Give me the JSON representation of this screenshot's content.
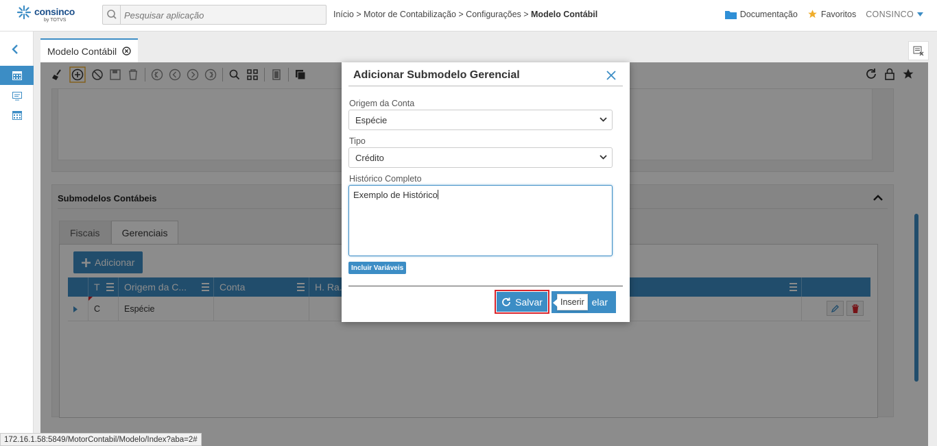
{
  "brand": {
    "name": "consinco",
    "sub": "by TOTVS"
  },
  "search": {
    "placeholder": "Pesquisar aplicação"
  },
  "breadcrumb": {
    "path": "Início > Motor de Contabilização > Configurações > ",
    "current": "Modelo Contábil"
  },
  "top_links": {
    "docs": "Documentação",
    "favorites": "Favoritos",
    "user": "CONSINCO"
  },
  "tab": {
    "label": "Modelo Contábil"
  },
  "section": {
    "title": "Submodelos Contábeis"
  },
  "subtabs": [
    {
      "label": "Fiscais"
    },
    {
      "label": "Gerenciais"
    }
  ],
  "grid": {
    "add_label": "Adicionar",
    "headers": {
      "t": "T",
      "origem": "Origem da C...",
      "conta": "Conta",
      "hra": "H. Ra..."
    },
    "row": {
      "t": "C",
      "origem": "Espécie"
    }
  },
  "modal": {
    "title": "Adicionar Submodelo Gerencial",
    "origem_label": "Origem da Conta",
    "origem_value": "Espécie",
    "tipo_label": "Tipo",
    "tipo_value": "Crédito",
    "historico_label": "Histórico Completo",
    "historico_value": "Exemplo de Histórico",
    "variables_button": "Incluir Variáveis",
    "save_label": "Salvar",
    "cancel_label": "elar",
    "tooltip": "Inserir"
  },
  "status_url": "172.16.1.58:5849/MotorContabil/Modelo/Index?aba=2#",
  "colors": {
    "accent": "#3c8dc5",
    "highlight": "#d8232a",
    "star": "#f0ad2b"
  }
}
